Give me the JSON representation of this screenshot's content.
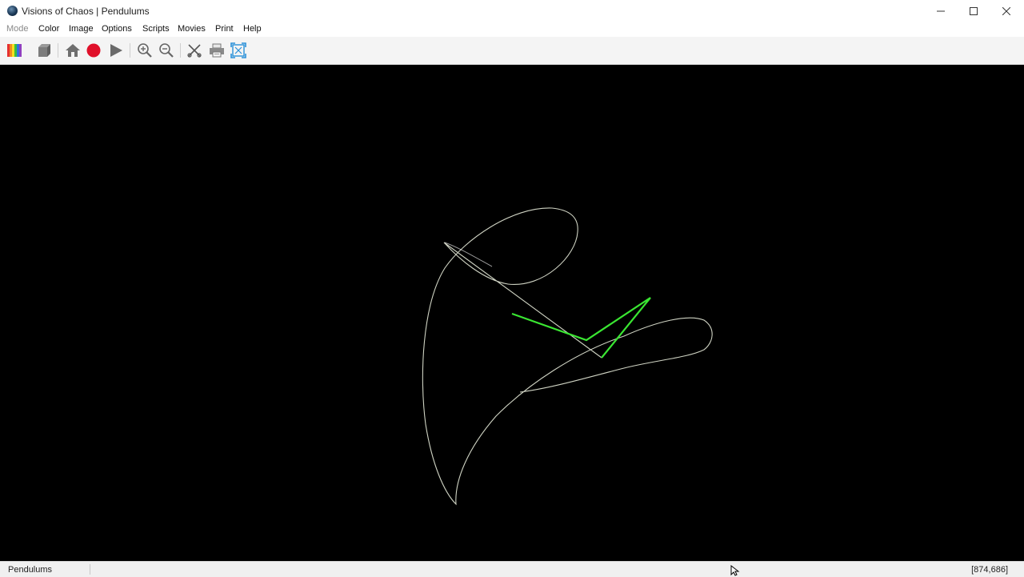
{
  "window": {
    "title": "Visions of Chaos | Pendulums",
    "minimize_icon": "minimize-icon",
    "maximize_icon": "maximize-icon",
    "close_icon": "close-icon"
  },
  "menu": {
    "items": [
      "Mode",
      "Color",
      "Image",
      "Options",
      "Scripts",
      "Movies",
      "Print",
      "Help"
    ]
  },
  "toolbar": {
    "icons": [
      "palette-icon",
      "cube-icon",
      "home-icon",
      "record-icon",
      "play-icon",
      "zoom-in-icon",
      "zoom-out-icon",
      "crop-icon",
      "print-icon",
      "fullscreen-icon"
    ]
  },
  "canvas": {
    "background": "#000000",
    "trail_color": "#e8ecd8",
    "pendulum_color": "#39e830"
  },
  "status": {
    "mode": "Pendulums",
    "coords": "[874,686]"
  }
}
